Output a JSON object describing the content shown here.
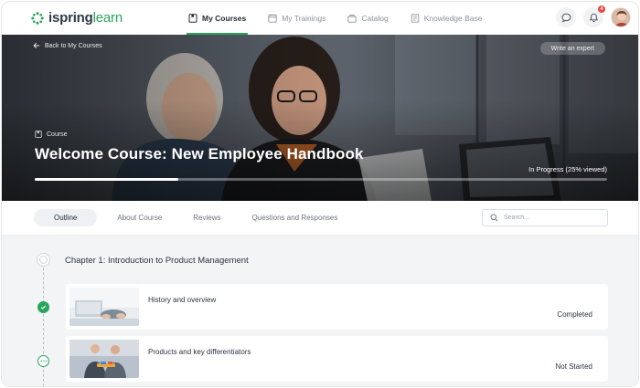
{
  "brand": {
    "name_part1": "ispring",
    "name_part2": "learn",
    "accent_color": "#2aa35c"
  },
  "nav": {
    "items": [
      {
        "label": "My Courses",
        "icon": "book-icon",
        "active": true
      },
      {
        "label": "My Trainings",
        "icon": "calendar-icon",
        "active": false
      },
      {
        "label": "Catalog",
        "icon": "catalog-icon",
        "active": false
      },
      {
        "label": "Knowledge Base",
        "icon": "knowledge-base-icon",
        "active": false
      }
    ],
    "notifications_count": "4"
  },
  "hero": {
    "back_label": "Back to My Courses",
    "write_expert_label": "Write an expert",
    "course_tag": "Course",
    "title": "Welcome Course: New Employee Handbook",
    "progress_text": "In Progress (25% viewed)",
    "progress_percent": 25
  },
  "tabs": [
    {
      "label": "Outline",
      "active": true
    },
    {
      "label": "About Course",
      "active": false
    },
    {
      "label": "Reviews",
      "active": false
    },
    {
      "label": "Questions and Responses",
      "active": false
    }
  ],
  "search": {
    "placeholder": "Search..."
  },
  "outline": {
    "chapter_title": "Chapter 1: Introduction to Product Management",
    "lessons": [
      {
        "title": "History and overview",
        "status": "Completed",
        "status_icon": "check-icon"
      },
      {
        "title": "Products and key differentiators",
        "status": "Not Started",
        "status_icon": "ellipsis-icon"
      }
    ]
  }
}
